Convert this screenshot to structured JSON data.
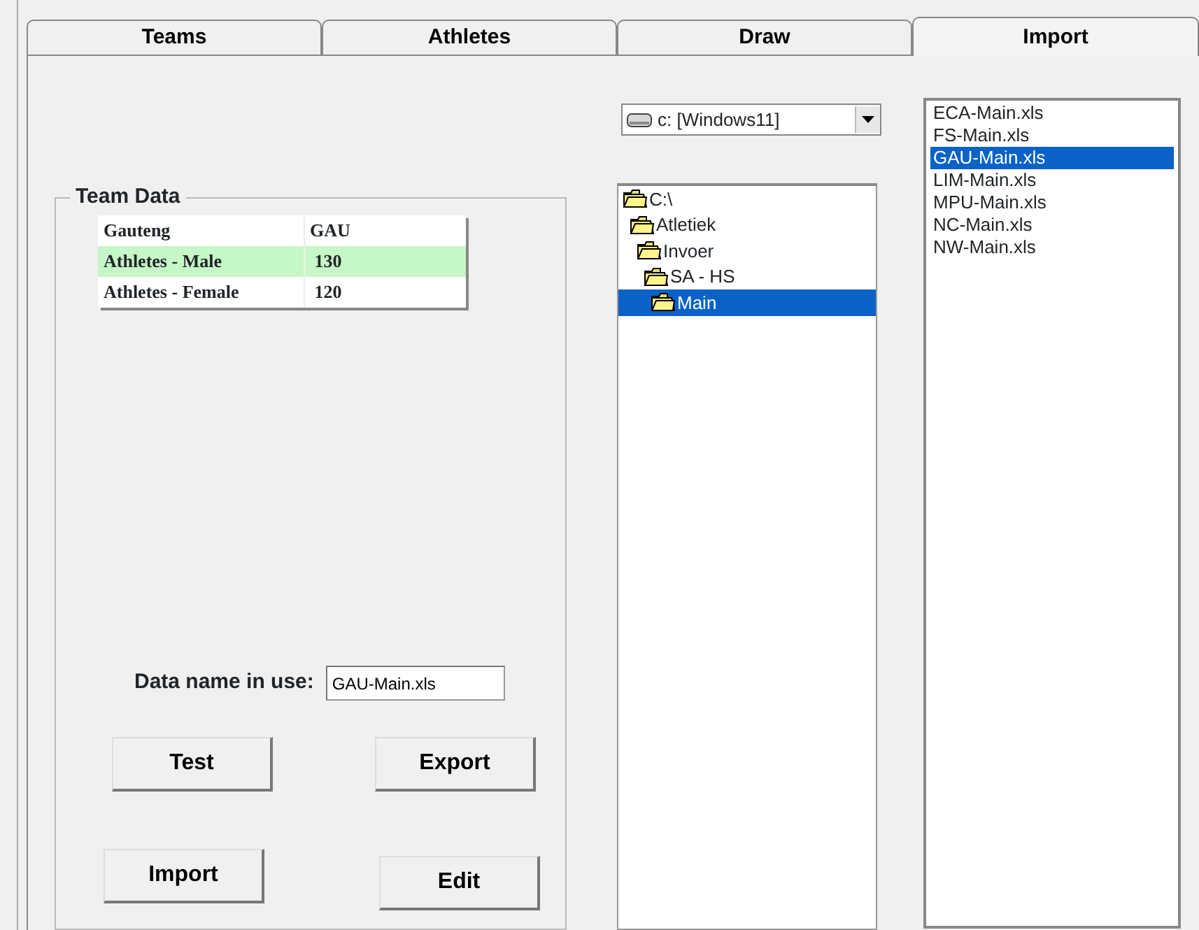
{
  "tabs": [
    {
      "label": "Teams",
      "selected": false
    },
    {
      "label": "Athletes",
      "selected": false
    },
    {
      "label": "Draw",
      "selected": false
    },
    {
      "label": "Import",
      "selected": true
    }
  ],
  "team_data": {
    "title": "Team Data",
    "rows": [
      {
        "cells": [
          "Gauteng",
          "GAU"
        ],
        "highlighted": false
      },
      {
        "cells": [
          "Athletes - Male",
          "130"
        ],
        "highlighted": true
      },
      {
        "cells": [
          "Athletes - Female",
          "120"
        ],
        "highlighted": false
      }
    ]
  },
  "data_name": {
    "label": "Data name in use:",
    "value": "GAU-Main.xls"
  },
  "buttons": [
    "Test",
    "Export",
    "Import",
    "Edit"
  ],
  "drive": {
    "value": "c: [Windows11]"
  },
  "folders": [
    {
      "name": "C:\\",
      "selected": false,
      "children": [
        {
          "name": "Atletiek",
          "selected": false,
          "children": [
            {
              "name": "Invoer",
              "selected": false,
              "children": [
                {
                  "name": "SA - HS",
                  "selected": false,
                  "children": [
                    {
                      "name": "Main",
                      "selected": true
                    }
                  ]
                }
              ]
            }
          ]
        }
      ]
    }
  ],
  "files": [
    {
      "name": "ECA-Main.xls",
      "selected": false
    },
    {
      "name": "FS-Main.xls",
      "selected": false
    },
    {
      "name": "GAU-Main.xls",
      "selected": true
    },
    {
      "name": "LIM-Main.xls",
      "selected": false
    },
    {
      "name": "MPU-Main.xls",
      "selected": false
    },
    {
      "name": "NC-Main.xls",
      "selected": false
    },
    {
      "name": "NW-Main.xls",
      "selected": false
    }
  ]
}
